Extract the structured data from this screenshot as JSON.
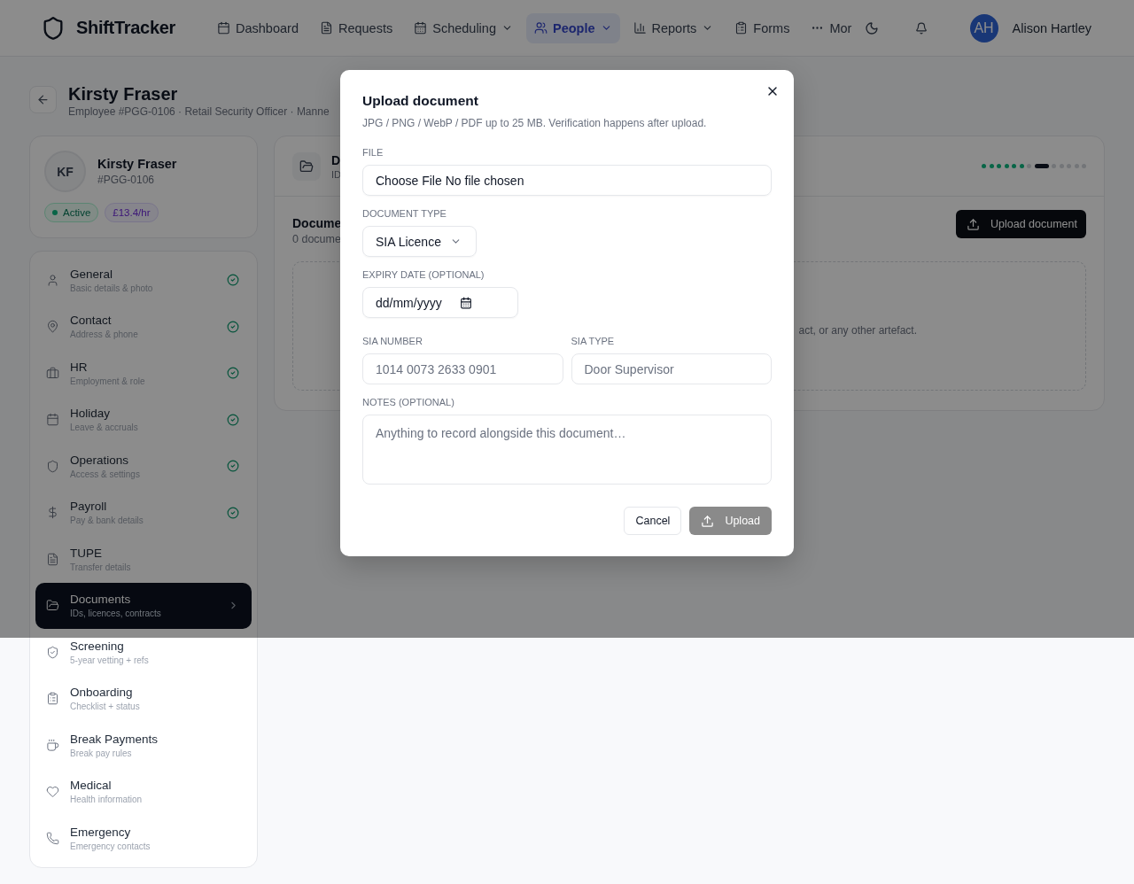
{
  "header": {
    "brand": "ShiftTracker",
    "nav": [
      {
        "label": "Dashboard",
        "selected": false,
        "dropdown": false
      },
      {
        "label": "Requests",
        "selected": false,
        "dropdown": false
      },
      {
        "label": "Scheduling",
        "selected": false,
        "dropdown": true
      },
      {
        "label": "People",
        "selected": true,
        "dropdown": true
      },
      {
        "label": "Reports",
        "selected": false,
        "dropdown": true
      },
      {
        "label": "Forms",
        "selected": false,
        "dropdown": false
      },
      {
        "label": "Mor",
        "selected": false,
        "dropdown": false
      }
    ],
    "user": {
      "initials": "AH",
      "name": "Alison Hartley"
    }
  },
  "page": {
    "title": "Kirsty Fraser",
    "subtitle": "Employee #PGG-0106 · Retail Security Officer · Manne"
  },
  "profile": {
    "initials": "KF",
    "name": "Kirsty Fraser",
    "id": "#PGG-0106",
    "status": "Active",
    "rate": "£13.4/hr"
  },
  "sidebar": {
    "items": [
      {
        "title": "General",
        "subtitle": "Basic details & photo",
        "complete": true,
        "selected": false
      },
      {
        "title": "Contact",
        "subtitle": "Address & phone",
        "complete": true,
        "selected": false
      },
      {
        "title": "HR",
        "subtitle": "Employment & role",
        "complete": true,
        "selected": false
      },
      {
        "title": "Holiday",
        "subtitle": "Leave & accruals",
        "complete": true,
        "selected": false
      },
      {
        "title": "Operations",
        "subtitle": "Access & settings",
        "complete": true,
        "selected": false
      },
      {
        "title": "Payroll",
        "subtitle": "Pay & bank details",
        "complete": true,
        "selected": false
      },
      {
        "title": "TUPE",
        "subtitle": "Transfer details",
        "complete": false,
        "selected": false
      },
      {
        "title": "Documents",
        "subtitle": "IDs, licences, contracts",
        "complete": false,
        "selected": true
      },
      {
        "title": "Screening",
        "subtitle": "5-year vetting + refs",
        "complete": false,
        "selected": false
      },
      {
        "title": "Onboarding",
        "subtitle": "Checklist + status",
        "complete": false,
        "selected": false
      },
      {
        "title": "Break Payments",
        "subtitle": "Break pay rules",
        "complete": false,
        "selected": false
      },
      {
        "title": "Medical",
        "subtitle": "Health information",
        "complete": false,
        "selected": false
      },
      {
        "title": "Emergency",
        "subtitle": "Emergency contacts",
        "complete": false,
        "selected": false
      }
    ]
  },
  "panel": {
    "title": "D",
    "subtitle": "ID",
    "section_title": "Docume",
    "section_count": "0 docume",
    "upload_button": "Upload document",
    "empty_text": "act, or any other artefact."
  },
  "modal": {
    "title": "Upload document",
    "subtitle": "JPG / PNG / WebP / PDF up to 25 MB. Verification happens after upload.",
    "file": {
      "label": "FILE",
      "button": "Choose File",
      "status": "No file chosen"
    },
    "document_type": {
      "label": "DOCUMENT TYPE",
      "value": "SIA Licence"
    },
    "expiry": {
      "label": "EXPIRY DATE (OPTIONAL)",
      "placeholder": "dd/mm/yyyy"
    },
    "sia_number": {
      "label": "SIA NUMBER",
      "placeholder": "1014 0073 2633 0901"
    },
    "sia_type": {
      "label": "SIA TYPE",
      "placeholder": "Door Supervisor"
    },
    "notes": {
      "label": "NOTES (OPTIONAL)",
      "placeholder": "Anything to record alongside this document…"
    },
    "cancel": "Cancel",
    "upload": {
      "label": "Upload",
      "disabled": true
    }
  }
}
